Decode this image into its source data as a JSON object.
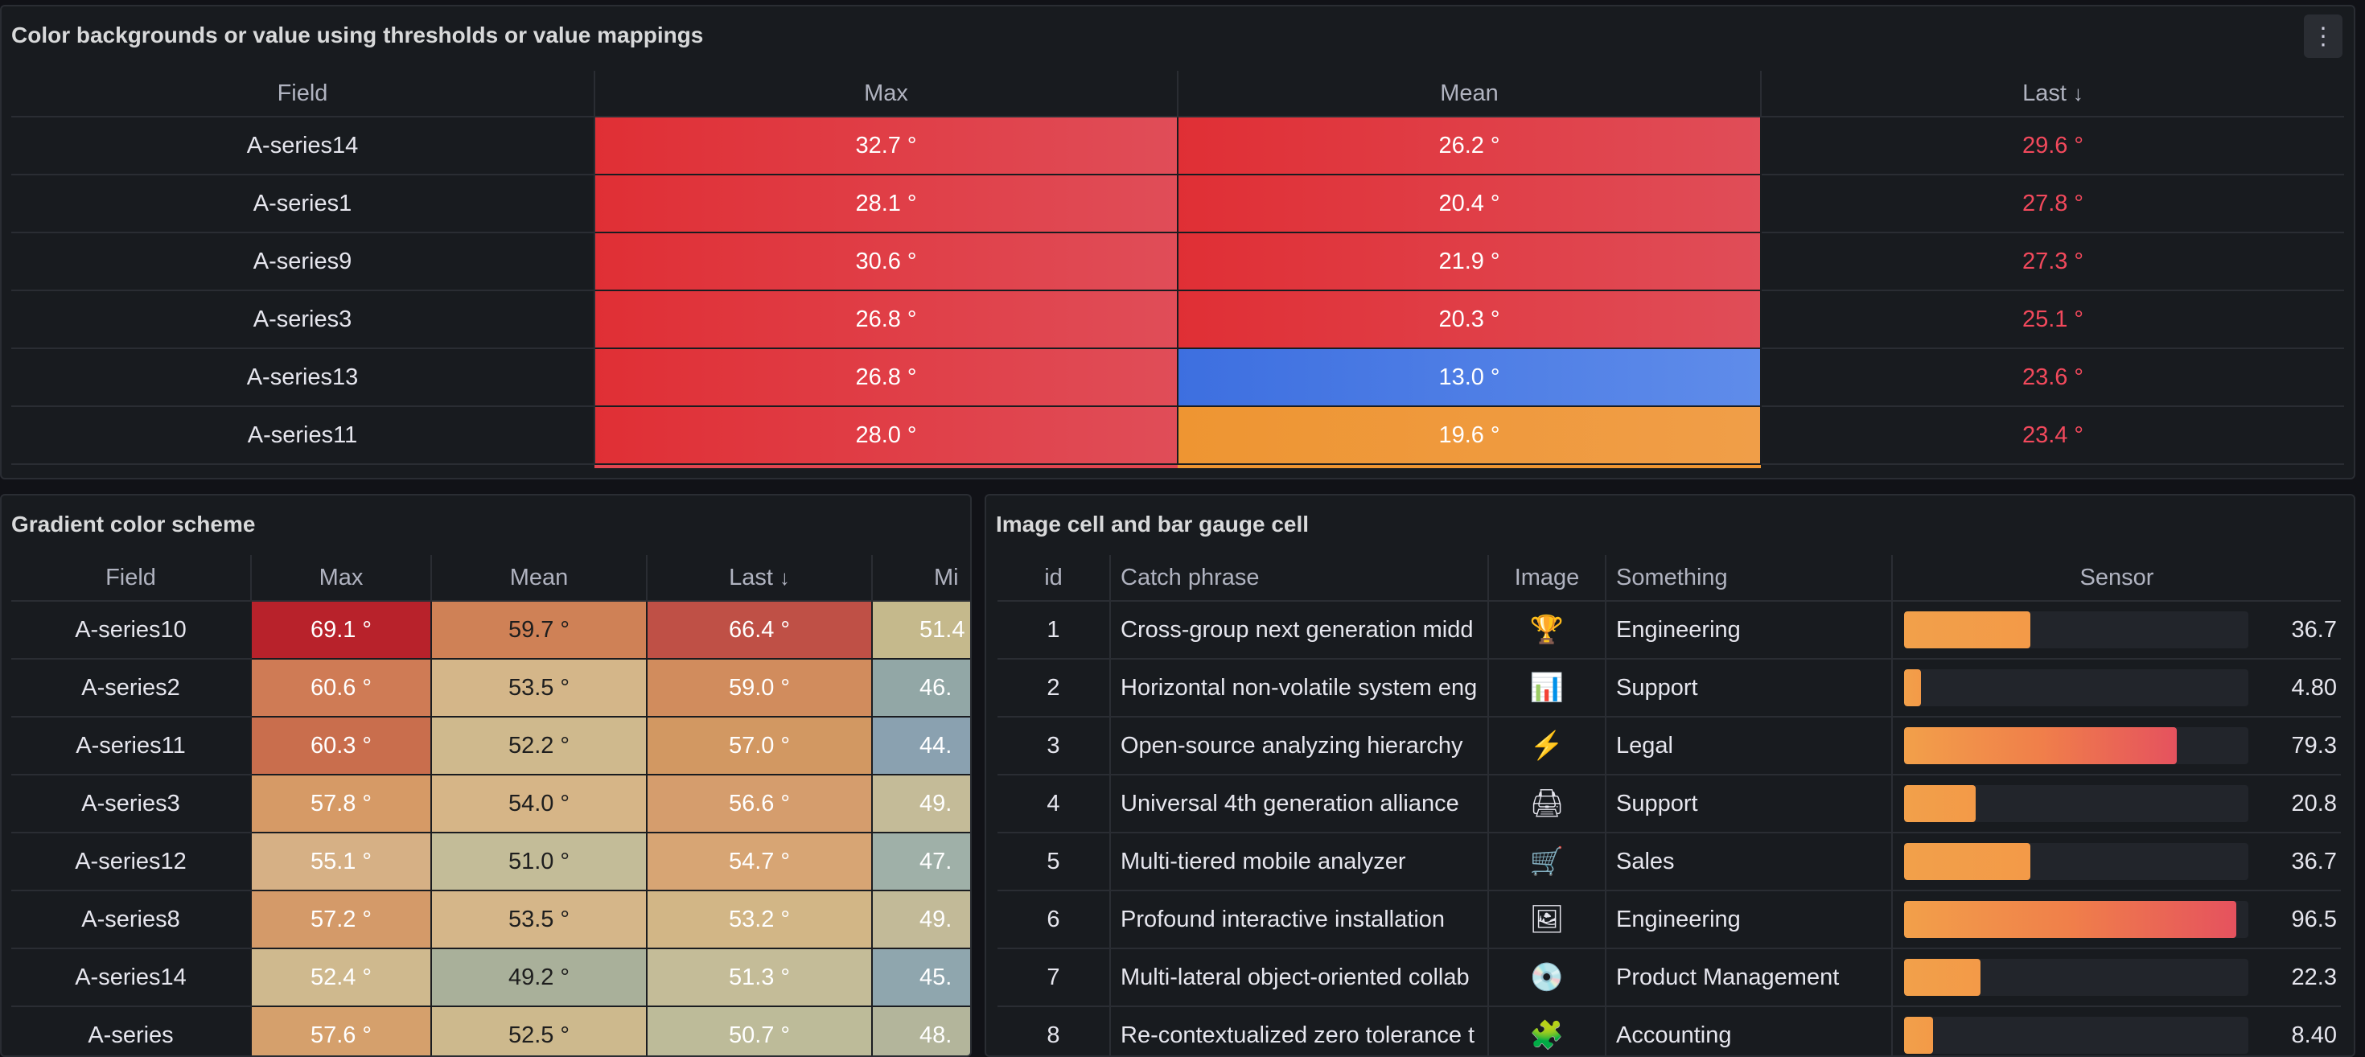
{
  "panel1": {
    "title": "Color backgrounds or value using thresholds or value mappings",
    "menu_icon": "kebab-menu-icon",
    "columns": [
      "Field",
      "Max",
      "Mean",
      "Last"
    ],
    "sort_icon": "arrow-down-icon",
    "rows": [
      {
        "field": "A-series14",
        "max": "32.7 °",
        "mean": "26.2 °",
        "last": "29.6 °",
        "mean_color": "red"
      },
      {
        "field": "A-series1",
        "max": "28.1 °",
        "mean": "20.4 °",
        "last": "27.8 °",
        "mean_color": "red"
      },
      {
        "field": "A-series9",
        "max": "30.6 °",
        "mean": "21.9 °",
        "last": "27.3 °",
        "mean_color": "red"
      },
      {
        "field": "A-series3",
        "max": "26.8 °",
        "mean": "20.3 °",
        "last": "25.1 °",
        "mean_color": "red"
      },
      {
        "field": "A-series13",
        "max": "26.8 °",
        "mean": "13.0 °",
        "last": "23.6 °",
        "mean_color": "blue"
      },
      {
        "field": "A-series11",
        "max": "28.0 °",
        "mean": "19.6 °",
        "last": "23.4 °",
        "mean_color": "orange"
      }
    ]
  },
  "panel2": {
    "title": "Gradient color scheme",
    "columns": [
      "Field",
      "Max",
      "Mean",
      "Last",
      "Mi"
    ],
    "rows": [
      {
        "field": "A-series10",
        "max": "69.1 °",
        "mean": "59.7 °",
        "last": "66.4 °",
        "min": "51.4",
        "c": [
          "#b8222b",
          "#cf8156",
          "#bf5046",
          "#c5b98c"
        ]
      },
      {
        "field": "A-series2",
        "max": "60.6 °",
        "mean": "53.5 °",
        "last": "59.0 °",
        "min": "46.",
        "c": [
          "#cf7b55",
          "#d4b689",
          "#d18c5d",
          "#92a7a6"
        ]
      },
      {
        "field": "A-series11",
        "max": "60.3 °",
        "mean": "52.2 °",
        "last": "57.0 °",
        "min": "44.",
        "c": [
          "#c96e4d",
          "#cfb98d",
          "#d29862",
          "#8aa1b0"
        ]
      },
      {
        "field": "A-series3",
        "max": "57.8 °",
        "mean": "54.0 °",
        "last": "56.6 °",
        "min": "49.",
        "c": [
          "#d69a66",
          "#d6b587",
          "#d59d6d",
          "#c4bb98"
        ]
      },
      {
        "field": "A-series12",
        "max": "55.1 °",
        "mean": "51.0 °",
        "last": "54.7 °",
        "min": "47.",
        "c": [
          "#d6b085",
          "#c3bc98",
          "#d7a574",
          "#9fb0a8"
        ]
      },
      {
        "field": "A-series8",
        "max": "57.2 °",
        "mean": "53.5 °",
        "last": "53.2 °",
        "min": "49.",
        "c": [
          "#d49a69",
          "#d5b689",
          "#d2b686",
          "#c2ba98"
        ]
      },
      {
        "field": "A-series14",
        "max": "52.4 °",
        "mean": "49.2 °",
        "last": "51.3 °",
        "min": "45.",
        "c": [
          "#cfb98e",
          "#a9b09a",
          "#c4bc98",
          "#8fa6ae"
        ]
      },
      {
        "field": "A-series",
        "max": "57.6 °",
        "mean": "52.5 °",
        "last": "50.7 °",
        "min": "48.",
        "c": [
          "#d5a06c",
          "#cdb98d",
          "#bdbb99",
          "#b3b59b"
        ]
      }
    ]
  },
  "panel3": {
    "title": "Image cell and bar gauge cell",
    "columns": [
      "id",
      "Catch phrase",
      "Image",
      "Something",
      "Sensor"
    ],
    "rows": [
      {
        "id": "1",
        "phrase": "Cross-group next generation midd",
        "icon": "trophy-icon",
        "glyph": "🏆",
        "something": "Engineering",
        "sensor": "36.7",
        "fraction": 0.367
      },
      {
        "id": "2",
        "phrase": "Horizontal non-volatile system eng",
        "icon": "bars-icon",
        "glyph": "📊",
        "something": "Support",
        "sensor": "4.80",
        "fraction": 0.048
      },
      {
        "id": "3",
        "phrase": "Open-source analyzing hierarchy",
        "icon": "lightning-icon",
        "glyph": "⚡",
        "something": "Legal",
        "sensor": "79.3",
        "fraction": 0.793
      },
      {
        "id": "4",
        "phrase": "Universal 4th generation alliance",
        "icon": "printer-icon",
        "glyph": "🖨",
        "something": "Support",
        "sensor": "20.8",
        "fraction": 0.208
      },
      {
        "id": "5",
        "phrase": "Multi-tiered mobile analyzer",
        "icon": "cart-icon",
        "glyph": "🛒",
        "something": "Sales",
        "sensor": "36.7",
        "fraction": 0.367
      },
      {
        "id": "6",
        "phrase": "Profound interactive installation",
        "icon": "picture-icon",
        "glyph": "🖼",
        "something": "Engineering",
        "sensor": "96.5",
        "fraction": 0.965
      },
      {
        "id": "7",
        "phrase": "Multi-lateral object-oriented collab",
        "icon": "disc-icon",
        "glyph": "💿",
        "something": "Product Management",
        "sensor": "22.3",
        "fraction": 0.223
      },
      {
        "id": "8",
        "phrase": "Re-contextualized zero tolerance t",
        "icon": "puzzle-icon",
        "glyph": "🧩",
        "something": "Accounting",
        "sensor": "8.40",
        "fraction": 0.084
      }
    ]
  }
}
